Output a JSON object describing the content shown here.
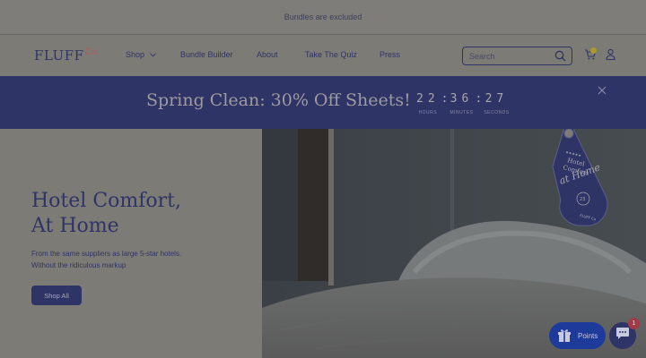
{
  "announcement": {
    "text": "Bundles are excluded"
  },
  "header": {
    "logo": {
      "name": "FLUFF",
      "suffix": "Co"
    },
    "nav": [
      {
        "label": "Shop"
      },
      {
        "label": "Bundle Builder"
      },
      {
        "label": "About"
      },
      {
        "label": "Take The Quiz"
      },
      {
        "label": "Press"
      }
    ],
    "search": {
      "placeholder": "Search"
    },
    "icons": {
      "search": "search-icon",
      "cart": "cart-icon",
      "account": "user-icon"
    }
  },
  "promo": {
    "text": "Spring Clean: 30% Off Sheets!",
    "countdown": {
      "hours": "22",
      "minutes": "36",
      "seconds": "27",
      "hours_label": "HOURS",
      "minutes_label": "MINUTES",
      "seconds_label": "SECONDS"
    }
  },
  "hero": {
    "title_line1": "Hotel Comfort,",
    "title_line2": "At Home",
    "subtitle_line1": "From the same suppliers as large 5-star hotels.",
    "subtitle_line2": "Without the ridiculous markup",
    "cta_label": "Shop All",
    "tag": {
      "stars": "★★★★★",
      "line1": "Hotel",
      "line2": "Comfort",
      "script": "at Home",
      "number": "23",
      "brand": "FLUFF Co"
    }
  },
  "widgets": {
    "points_label": "Points",
    "chat_badge": "1"
  },
  "colors": {
    "brand_navy": "#2f3466",
    "overlay_gray": "#7d7b76",
    "points_blue": "#1e3a9a",
    "badge_red": "#a33a48"
  }
}
